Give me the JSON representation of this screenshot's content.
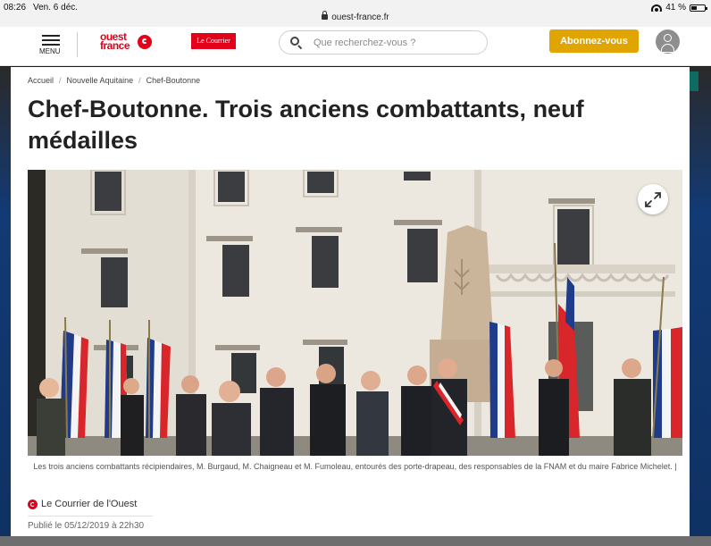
{
  "status_bar": {
    "time": "08:26",
    "date": "Ven. 6 déc.",
    "url": "ouest-france.fr",
    "battery": "41 %",
    "battery_level": 0.41
  },
  "header": {
    "menu_label": "MENU",
    "logo_ouest_france": "ouest france",
    "logo_courrier": "Le Courrier",
    "search_placeholder": "Que recherchez-vous ?",
    "subscribe_label": "Abonnez-vous",
    "subscribe_color": "#e0a500",
    "brand_color": "#e2001a"
  },
  "article": {
    "breadcrumb": [
      "Accueil",
      "Nouvelle Aquitaine",
      "Chef-Boutonne"
    ],
    "title": "Chef-Boutonne. Trois anciens combattants, neuf médailles",
    "caption": "Les trois anciens combattants récipiendaires, M. Burgaud, M. Chaigneau et M. Fumoleau, entourés des porte-drapeau, des responsables de la FNAM et du maire Fabrice Michelet. |",
    "source": "Le Courrier de l'Ouest",
    "published": "Publié le 05/12/2019 à 22h30"
  }
}
